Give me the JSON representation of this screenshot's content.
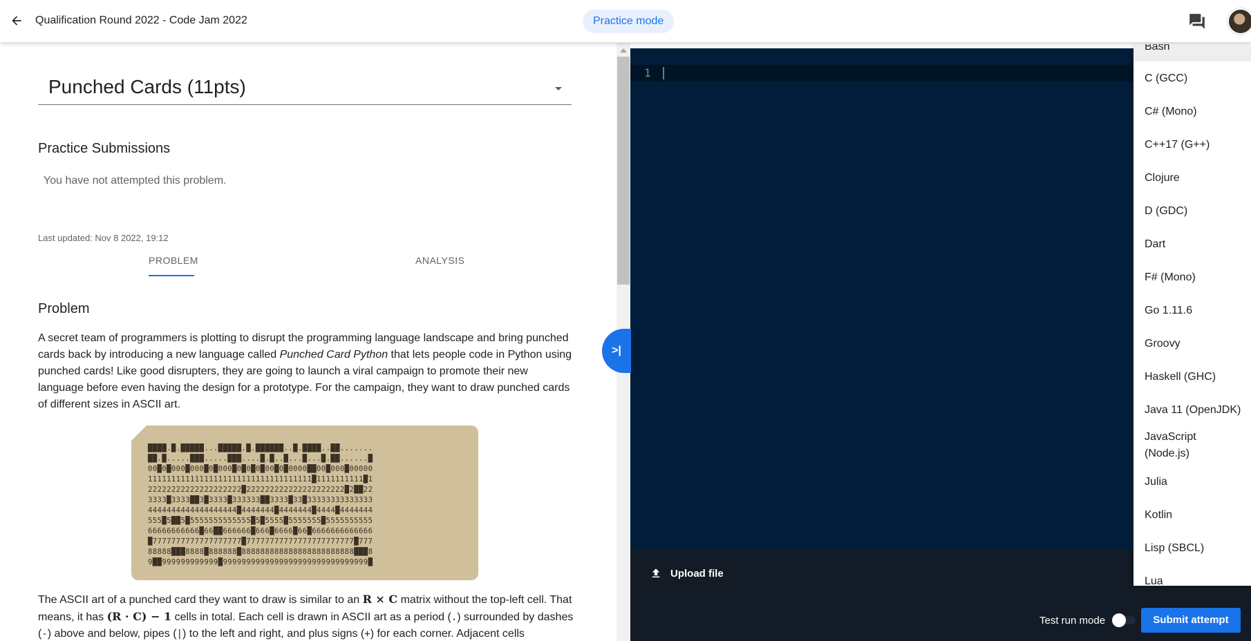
{
  "header": {
    "title": "Qualification Round 2022 - Code Jam 2022",
    "mode": "Practice mode"
  },
  "problem": {
    "selected": "Punched Cards (11pts)",
    "submissions_heading": "Practice Submissions",
    "submissions_empty": "You have not attempted this problem.",
    "last_updated": "Last updated: Nov 8 2022, 19:12",
    "tabs": [
      "PROBLEM",
      "ANALYSIS"
    ],
    "section_heading": "Problem",
    "para1_a": "A secret team of programmers is plotting to disrupt the programming language landscape and bring punched cards back by introducing a new language called ",
    "para1_em": "Punched Card Python",
    "para1_b": " that lets people code in Python using punched cards! Like good disrupters, they are going to launch a viral campaign to promote their new language before even having the design for a prototype. For the campaign, they want to draw punched cards of different sizes in ASCII art.",
    "para2_a": "The ASCII art of a punched card they want to draw is similar to an ",
    "para2_m1": "R × C",
    "para2_b": " matrix without the top-left cell. That means, it has ",
    "para2_m2": "(R · C) − 1",
    "para2_c": " cells in total. Each cell is drawn in ASCII art as a period (",
    "para2_c1": ".",
    "para2_d": ") surrounded by dashes (",
    "para2_c2": "-",
    "para2_e": ") above and below, pipes (",
    "para2_c3": "|",
    "para2_f": ") to the left and right, and plus signs (",
    "para2_c4": "+",
    "para2_g": ") for each corner. Adjacent cells"
  },
  "card_art": [
    "████.█.█████...█████.█.██████..█.████..██.......",
    "██.█.....███.....███....█.█..█...█...█.██......█",
    "00█0█000█000█0█000█0█0█0█00█0█0000██00█000█00000",
    "11111111111111111111111111111111111█1111111111█1",
    "22222222222222222222█222222222222222222222█2██22",
    "3333█3333██3█3333█333333██3333█33█33333333333333",
    "4444444444444444444█4444444█4444444█4444█4444444",
    "555█5██5█5555555555555█5█5555█5555555█5555555555",
    "66666666666█66██666666█666█6666█66█6666666666666",
    "█7777777777777777777█77777777777777777777777█777",
    "88888███8888█888888█888888888888888888888888███8",
    "9██999999999999█9999999999999999999999999999999█"
  ],
  "editor": {
    "line_number": "1"
  },
  "bottom": {
    "upload_label": "Upload file",
    "test_run_label": "Test run mode",
    "submit_label": "Submit attempt"
  },
  "languages": [
    "Bash",
    "C (GCC)",
    "C# (Mono)",
    "C++17 (G++)",
    "Clojure",
    "D (GDC)",
    "Dart",
    "F# (Mono)",
    "Go 1.11.6",
    "Groovy",
    "Haskell (GHC)",
    "Java 11 (OpenJDK)",
    "JavaScript (Node.js)",
    "Julia",
    "Kotlin",
    "Lisp (SBCL)",
    "Lua"
  ],
  "colors": {
    "accent": "#1a73e8",
    "editor_bg": "#021d39",
    "bottom_bar": "#131b26",
    "card": "#cfc09b"
  }
}
